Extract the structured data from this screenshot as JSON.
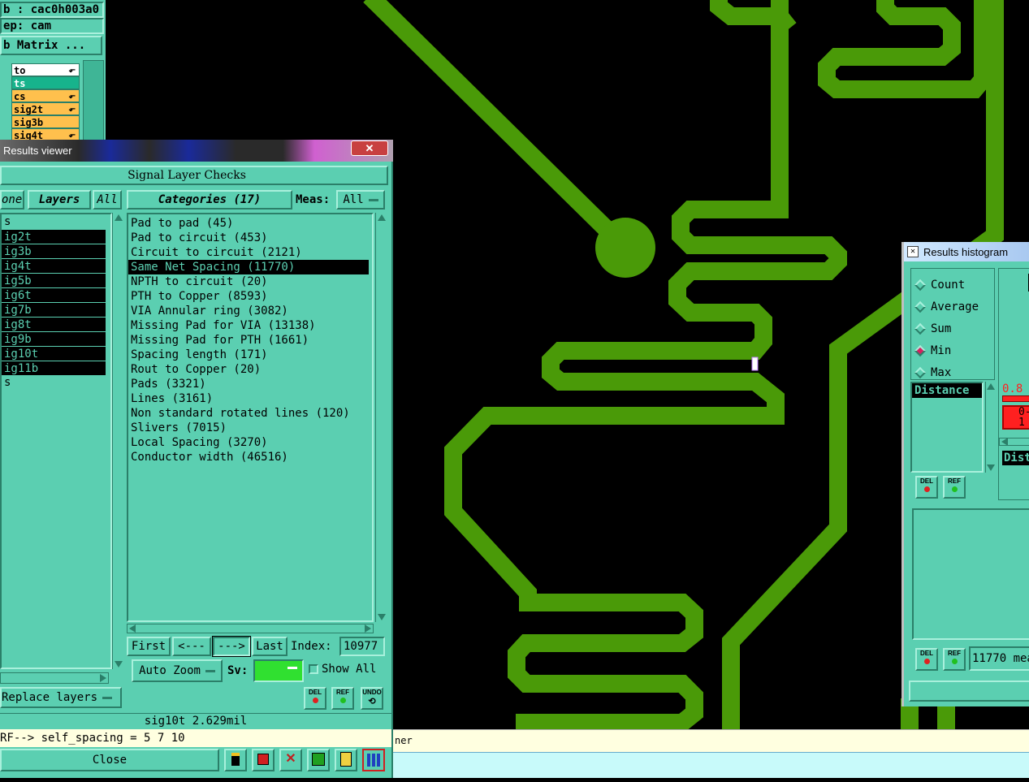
{
  "top_left": {
    "job_label": "b : cac0h003a0",
    "step_label": "ep: cam",
    "matrix_button": "b Matrix ...",
    "layers": [
      {
        "name": "to",
        "bg": "#ffffff"
      },
      {
        "name": "ts",
        "bg": "#17b38c"
      },
      {
        "name": "cs",
        "bg": "#ffc04d"
      },
      {
        "name": "sig2t",
        "bg": "#ffc04d"
      },
      {
        "name": "sig3b",
        "bg": "#ffc04d"
      },
      {
        "name": "sig4t",
        "bg": "#ffc04d"
      }
    ]
  },
  "results_viewer": {
    "title": "Results viewer",
    "close_glyph": "✕",
    "header": "Signal Layer Checks",
    "tabs": {
      "none": "one",
      "layers": "Layers",
      "all": "All"
    },
    "categories_tab": "Categories (17)",
    "meas_label": "Meas:",
    "meas_value": "All",
    "layer_list": [
      {
        "label": "s",
        "selected": false
      },
      {
        "label": "ig2t",
        "selected": true
      },
      {
        "label": "ig3b",
        "selected": true
      },
      {
        "label": "ig4t",
        "selected": true
      },
      {
        "label": "ig5b",
        "selected": true
      },
      {
        "label": "ig6t",
        "selected": true
      },
      {
        "label": "ig7b",
        "selected": true
      },
      {
        "label": "ig8t",
        "selected": true
      },
      {
        "label": "ig9b",
        "selected": true
      },
      {
        "label": "ig10t",
        "selected": true
      },
      {
        "label": "ig11b",
        "selected": true
      },
      {
        "label": "s",
        "selected": false
      }
    ],
    "categories": [
      {
        "label": "Pad to pad (45)",
        "selected": false
      },
      {
        "label": "Pad to circuit (453)",
        "selected": false
      },
      {
        "label": "Circuit to circuit (2121)",
        "selected": false
      },
      {
        "label": "Same Net Spacing (11770)",
        "selected": true
      },
      {
        "label": "NPTH to circuit (20)",
        "selected": false
      },
      {
        "label": "PTH to Copper (8593)",
        "selected": false
      },
      {
        "label": "VIA Annular ring (3082)",
        "selected": false
      },
      {
        "label": "Missing Pad for VIA (13138)",
        "selected": false
      },
      {
        "label": "Missing Pad for PTH (1661)",
        "selected": false
      },
      {
        "label": "Spacing length (171)",
        "selected": false
      },
      {
        "label": "Rout to Copper (20)",
        "selected": false
      },
      {
        "label": "Pads (3321)",
        "selected": false
      },
      {
        "label": "Lines (3161)",
        "selected": false
      },
      {
        "label": "Non standard rotated lines (120)",
        "selected": false
      },
      {
        "label": "Slivers (7015)",
        "selected": false
      },
      {
        "label": "Local Spacing (3270)",
        "selected": false
      },
      {
        "label": "Conductor width (46516)",
        "selected": false
      }
    ],
    "nav": {
      "first": "First",
      "prev": "<---",
      "next": "--->",
      "last": "Last",
      "index_label": "Index:",
      "index_value": "10977"
    },
    "auto_zoom": "Auto Zoom",
    "sv_label": "Sv:",
    "show_all": "Show All",
    "replace_layers": "Replace layers",
    "del": "DEL",
    "ref": "REF",
    "undo": "UNDO",
    "status": "sig10t 2.629mil",
    "command": "RF--> self_spacing = 5 7 10",
    "close": "Close"
  },
  "histogram": {
    "title": "Results histogram",
    "options": [
      {
        "label": "Count",
        "on": false
      },
      {
        "label": "Average",
        "on": false
      },
      {
        "label": "Sum",
        "on": false
      },
      {
        "label": "Min",
        "on": true
      },
      {
        "label": "Max",
        "on": false
      }
    ],
    "list_item": "Distance",
    "value_text": "0.8",
    "range_text": "0-",
    "range_sub": "1",
    "dist_label": "Dist",
    "del": "DEL",
    "ref": "REF",
    "count_text": "11770 mea"
  },
  "bottom_bar": {
    "text": "ner"
  },
  "colors": {
    "teal": "#5bcfb1",
    "copper": "#4a9a08",
    "highlight_red": "#ff2020"
  }
}
